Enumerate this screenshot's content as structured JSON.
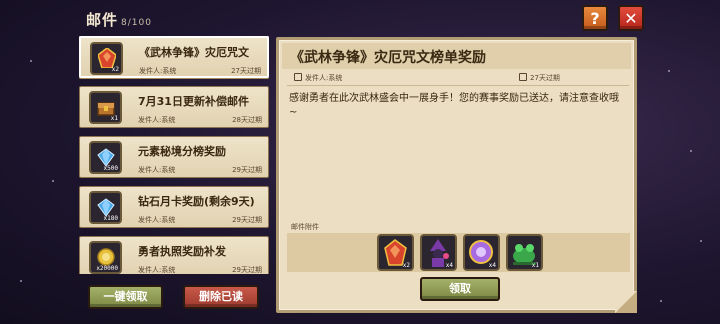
{
  "header": {
    "title": "邮件",
    "count": "8/100",
    "help_label": "?",
    "close_label": "✕"
  },
  "mails": [
    {
      "title": "《武林争锋》灾厄咒文",
      "sender": "发件人:系统",
      "expire": "27天过期",
      "qty": "x2",
      "icon": "red-gem-icon",
      "color": "#d8452c",
      "selected": true
    },
    {
      "title": "7月31日更新补偿邮件",
      "sender": "发件人:系统",
      "expire": "28天过期",
      "qty": "x1",
      "icon": "treasure-chest-icon",
      "color": "#b8742c",
      "selected": false
    },
    {
      "title": "元素秘境分榜奖励",
      "sender": "发件人:系统",
      "expire": "29天过期",
      "qty": "x500",
      "icon": "diamond-icon",
      "color": "#4aa8e8",
      "selected": false
    },
    {
      "title": "钻石月卡奖励(剩余9天)",
      "sender": "发件人:系统",
      "expire": "29天过期",
      "qty": "x180",
      "icon": "diamond-icon",
      "color": "#4aa8e8",
      "selected": false
    },
    {
      "title": "勇者执照奖励补发",
      "sender": "发件人:系统",
      "expire": "29天过期",
      "qty": "x20000",
      "icon": "gold-coin-icon",
      "color": "#e8c23a",
      "selected": false
    }
  ],
  "buttons": {
    "claim_all": "一键领取",
    "delete_read": "删除已读",
    "claim": "领取"
  },
  "detail": {
    "title": "《武林争锋》灾厄咒文榜单奖励",
    "sender": "发件人:系统",
    "expire": "27天过期",
    "body": "感谢勇者在此次武林盛会中一展身手！您的赛事奖励已送达，请注意查收哦~",
    "attachments_label": "邮件附件",
    "attachments": [
      {
        "icon": "red-gem-icon",
        "qty": "x2",
        "color": "#d8452c"
      },
      {
        "icon": "wizard-figure-icon",
        "qty": "x4",
        "color": "#7a3aa8"
      },
      {
        "icon": "purple-orb-icon",
        "qty": "x4",
        "color": "#a86ae0"
      },
      {
        "icon": "green-creature-icon",
        "qty": "x1",
        "color": "#3aa84a"
      }
    ]
  }
}
